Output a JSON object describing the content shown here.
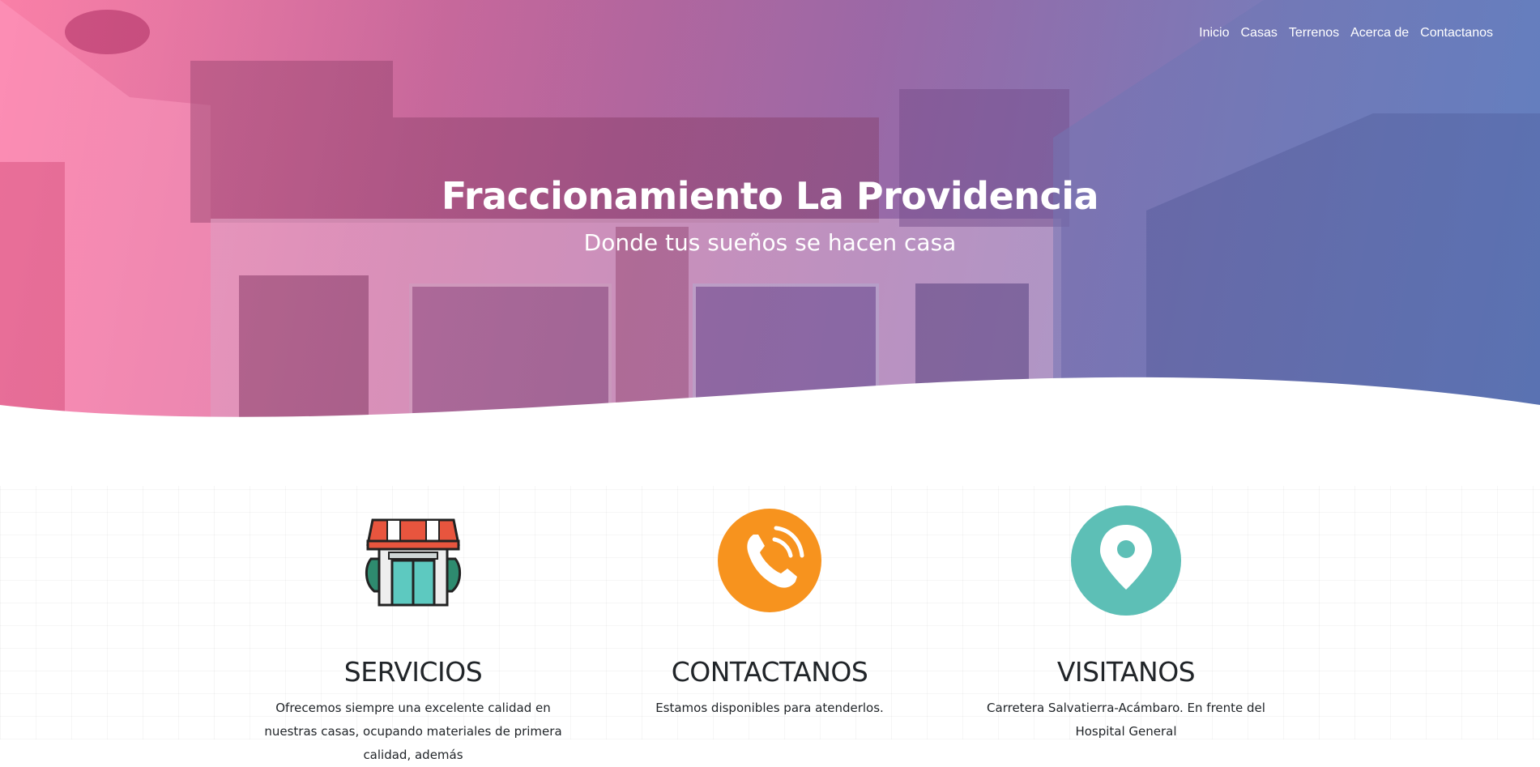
{
  "nav": {
    "items": [
      "Inicio",
      "Casas",
      "Terrenos",
      "Acerca de",
      "Contactanos"
    ]
  },
  "hero": {
    "title": "Fraccionamiento La Providencia",
    "subtitle": "Donde tus sueños se hacen casa"
  },
  "features": {
    "servicios": {
      "title": "SERVICIOS",
      "text": "Ofrecemos siempre una excelente calidad en nuestras casas, ocupando materiales de primera calidad, además",
      "icon": "storefront-icon"
    },
    "contactanos": {
      "title": "CONTACTANOS",
      "text": "Estamos disponibles para atenderlos.",
      "icon": "phone-icon"
    },
    "visitanos": {
      "title": "VISITANOS",
      "text": "Carretera Salvatierra-Acámbaro. En frente del Hospital General",
      "icon": "location-pin-icon"
    }
  },
  "colors": {
    "phone_circle": "#f7931e",
    "pin_circle": "#5dbfb6",
    "hero_gradient_start": "#f784a6",
    "hero_gradient_end": "#5f86c4"
  }
}
